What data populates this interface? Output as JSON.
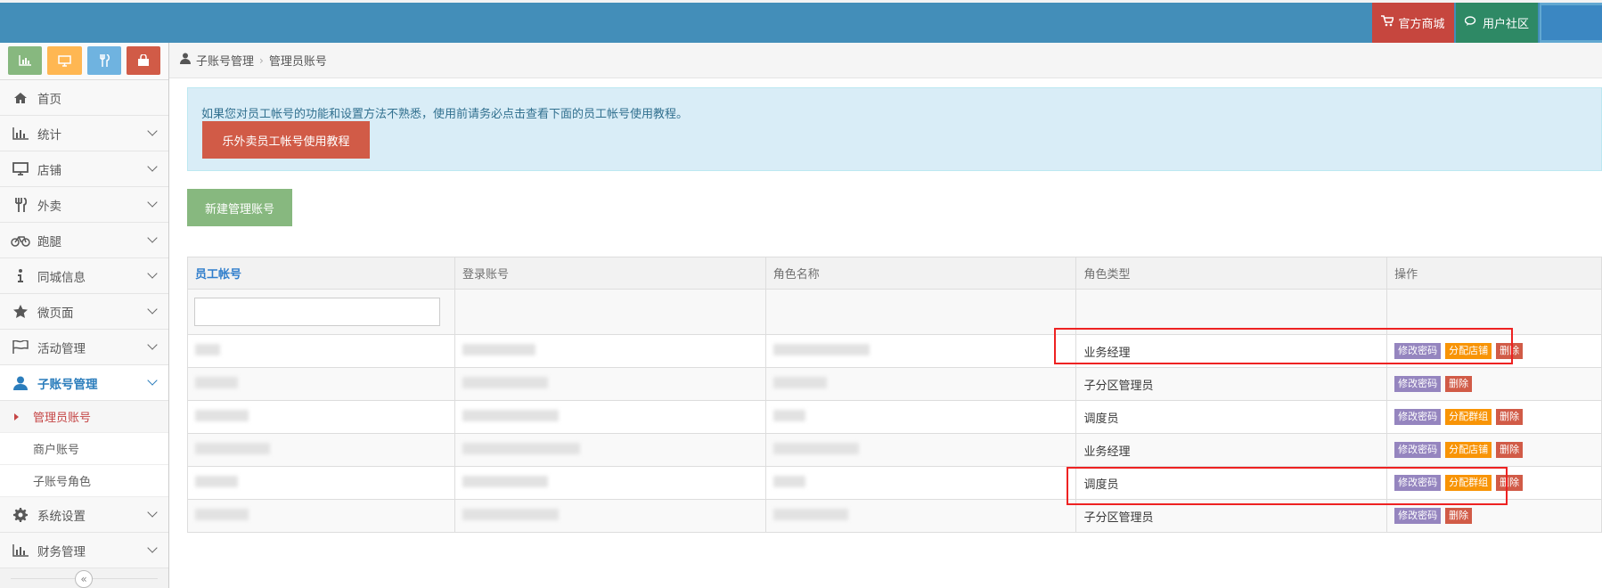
{
  "topbar": {
    "shop_label": "官方商城",
    "community_label": "用户社区"
  },
  "sidebar": {
    "shortcuts": [
      "chart-icon",
      "desktop-icon",
      "cutlery-icon",
      "shopping-bag-icon"
    ],
    "items": [
      {
        "label": "首页",
        "icon": "home-icon"
      },
      {
        "label": "统计",
        "icon": "bar-chart-icon"
      },
      {
        "label": "店铺",
        "icon": "desktop-icon"
      },
      {
        "label": "外卖",
        "icon": "cutlery-icon"
      },
      {
        "label": "跑腿",
        "icon": "bicycle-icon"
      },
      {
        "label": "同城信息",
        "icon": "info-icon"
      },
      {
        "label": "微页面",
        "icon": "star-icon"
      },
      {
        "label": "活动管理",
        "icon": "flag-icon"
      },
      {
        "label": "子账号管理",
        "icon": "user-icon"
      },
      {
        "label": "系统设置",
        "icon": "gear-icon"
      },
      {
        "label": "财务管理",
        "icon": "bar-chart-icon"
      }
    ],
    "subitems": [
      "管理员账号",
      "商户账号",
      "子账号角色"
    ]
  },
  "breadcrumb": {
    "parent": "子账号管理",
    "current": "管理员账号"
  },
  "alert": {
    "text": "如果您对员工帐号的功能和设置方法不熟悉，使用前请务必点击查看下面的员工帐号使用教程。",
    "button": "乐外卖员工帐号使用教程"
  },
  "new_button": "新建管理账号",
  "table": {
    "headers": [
      "员工帐号",
      "登录账号",
      "角色名称",
      "角色类型",
      "操作"
    ],
    "rows": [
      {
        "role_type": "业务经理",
        "ops": [
          "修改密码",
          "分配店铺",
          "删除"
        ]
      },
      {
        "role_type": "子分区管理员",
        "ops": [
          "修改密码",
          "删除"
        ]
      },
      {
        "role_type": "调度员",
        "ops": [
          "修改密码",
          "分配群组",
          "删除"
        ]
      },
      {
        "role_type": "业务经理",
        "ops": [
          "修改密码",
          "分配店铺",
          "删除"
        ]
      },
      {
        "role_type": "调度员",
        "ops": [
          "修改密码",
          "分配群组",
          "删除"
        ]
      },
      {
        "role_type": "子分区管理员",
        "ops": [
          "修改密码",
          "删除"
        ]
      }
    ]
  },
  "colors": {
    "topbar": "#438eb9",
    "accent": "#2b7dbc",
    "danger": "#d15b47",
    "highlight": "#e22222"
  }
}
